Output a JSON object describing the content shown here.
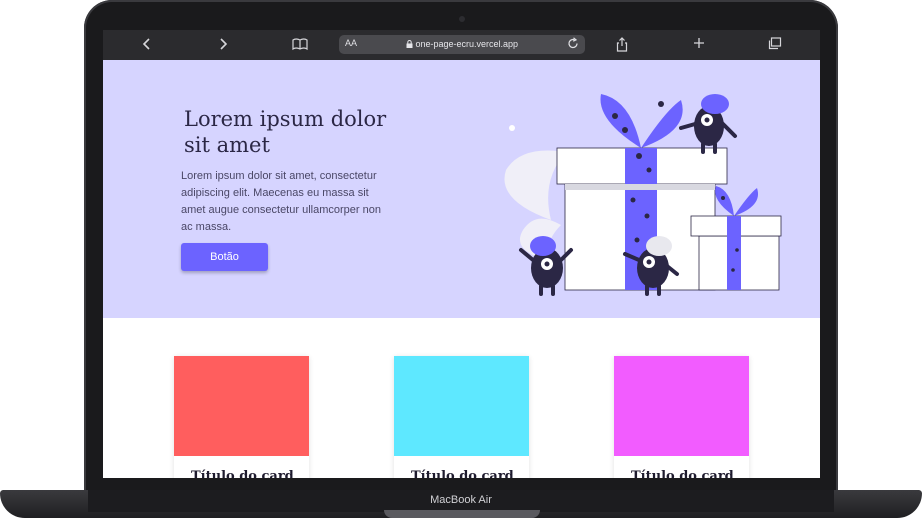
{
  "device": {
    "label": "MacBook Air"
  },
  "browser": {
    "text_size_label": "AA",
    "url": "one-page-ecru.vercel.app",
    "icons": [
      "back-icon",
      "forward-icon",
      "book-icon",
      "lock-icon",
      "reload-icon",
      "share-icon",
      "plus-icon",
      "tabs-icon"
    ]
  },
  "hero": {
    "title": "Lorem ipsum dolor sit amet",
    "text": "Lorem ipsum dolor sit amet, consectetur adipiscing elit. Maecenas eu massa sit amet augue consectetur ullamcorper non ac massa.",
    "button_label": "Botão",
    "background": "#d6d4ff",
    "accent": "#6c63ff"
  },
  "cards": [
    {
      "title": "Título do card",
      "color": "#ff5e5e"
    },
    {
      "title": "Título do card",
      "color": "#5ee8ff"
    },
    {
      "title": "Título do card",
      "color": "#f25cff"
    }
  ]
}
